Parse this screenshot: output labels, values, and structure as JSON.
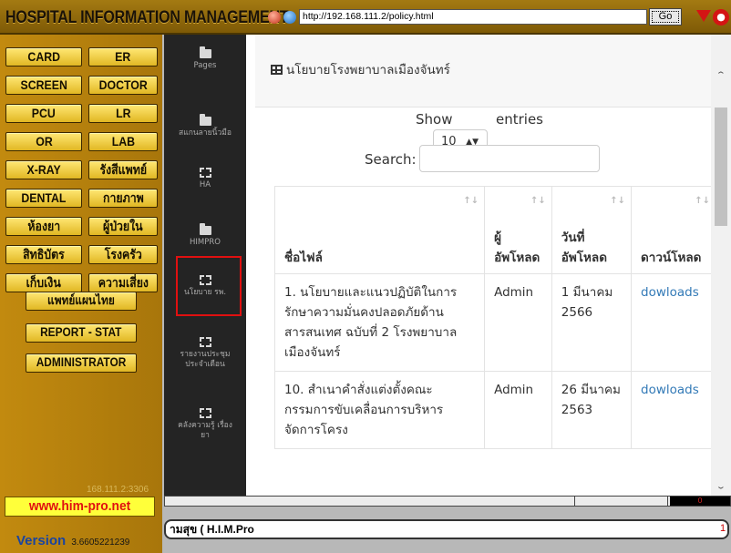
{
  "app": {
    "title": "HOSPITAL  INFORMATION  MANAGEMENT",
    "url": "http://192.168.111.2/policy.html",
    "go_label": "Go",
    "close_glyph": "●"
  },
  "menu": {
    "card": "CARD",
    "er": "ER",
    "screen": "SCREEN",
    "doctor": "DOCTOR",
    "pcu": "PCU",
    "lr": "LR",
    "or": "OR",
    "lab": "LAB",
    "xray": "X-RAY",
    "rx": "รังสีแพทย์",
    "dental": "DENTAL",
    "physio": "กายภาพ",
    "pharmacy": "ห้องยา",
    "patient": "ผู้ป่วยใน",
    "rights": "สิทธิบัตร",
    "kitchen": "โรงครัว",
    "billing": "เก็บเงิน",
    "risk": "ความเสี่ยง",
    "thai_medicine": "แพทย์แผนไทย",
    "report": "REPORT - STAT",
    "admin": "ADMINISTRATOR"
  },
  "left_footer": {
    "ip_hint": "168.111.2:3306",
    "link": "www.him-pro.net",
    "version_label": "Version",
    "version_number": "3.6605221239"
  },
  "sidebar": {
    "items": [
      {
        "label": "Pages"
      },
      {
        "label": "สแกนลายนิ้วมือ"
      },
      {
        "label": "HA"
      },
      {
        "label": "HIMPRO"
      },
      {
        "label": "นโยบาย รพ."
      },
      {
        "label": "รายงานประชุม ประจำเดือน"
      },
      {
        "label": "คลังความรู้ เรื่องยา"
      }
    ]
  },
  "page": {
    "card_title": "นโยบายโรงพยาบาลเมืองจันทร์",
    "show_label": "Show",
    "entries_value": "10",
    "entries_label": "entries",
    "search_label": "Search:",
    "search_value": "",
    "columns": [
      "ชื่อไฟล์",
      "ผู้อัพโหลด",
      "วันที่อัพโหลด",
      "ดาวน์โหลด"
    ],
    "rows": [
      {
        "name": "1. นโยบายและแนวปฏิบัติในการรักษาความมั่นคงปลอดภัยด้านสารสนเทศ ฉบับที่ 2 โรงพยาบาลเมืองจันทร์",
        "uploader": "Admin",
        "date": "1 มีนาคม 2566",
        "download": "dowloads"
      },
      {
        "name": "10. สำเนาคำสั่งแต่งตั้งคณะกรรมการขับเคลื่อนการบริหารจัดการโครง",
        "uploader": "Admin",
        "date": "26 มีนาคม 2563",
        "download": "dowloads"
      }
    ]
  },
  "hscroll_value": "0",
  "status": {
    "text": "ามสุข   ( H.I.M.Pro",
    "number": "1"
  },
  "colors": {
    "gold_panel": "#b6800d",
    "button_yellow": "#ffe774",
    "link_red": "#e01010",
    "sidebar_dark": "#242424",
    "link_blue": "#337ab7"
  }
}
